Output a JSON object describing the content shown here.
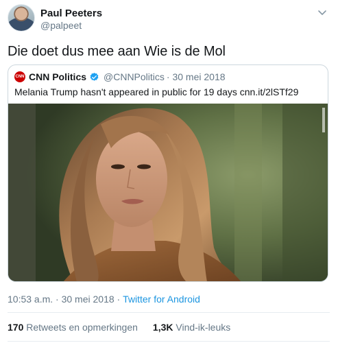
{
  "author": {
    "name": "Paul Peeters",
    "handle": "@palpeet"
  },
  "tweet": {
    "text": "Die doet dus mee aan Wie is de Mol"
  },
  "quoted": {
    "name": "CNN Politics",
    "handle": "@CNNPolitics",
    "date": "· 30 mei 2018",
    "text": "Melania Trump hasn't appeared in public for 19 days cnn.it/2lSTf29",
    "logo_text": "CNN"
  },
  "meta": {
    "time": "10:53 a.m. · 30 mei 2018 · ",
    "source": "Twitter for Android"
  },
  "stats": {
    "retweets_count": "170",
    "retweets_label": " Retweets en opmerkingen",
    "likes_count": "1,3K",
    "likes_label": " Vind-ik-leuks"
  },
  "colors": {
    "link": "#1b95e0",
    "muted": "#657786",
    "verified": "#1da1f2",
    "cnn_red": "#cc0000"
  },
  "icons": {
    "caret": "chevron-down-icon",
    "verified": "verified-badge-icon"
  }
}
